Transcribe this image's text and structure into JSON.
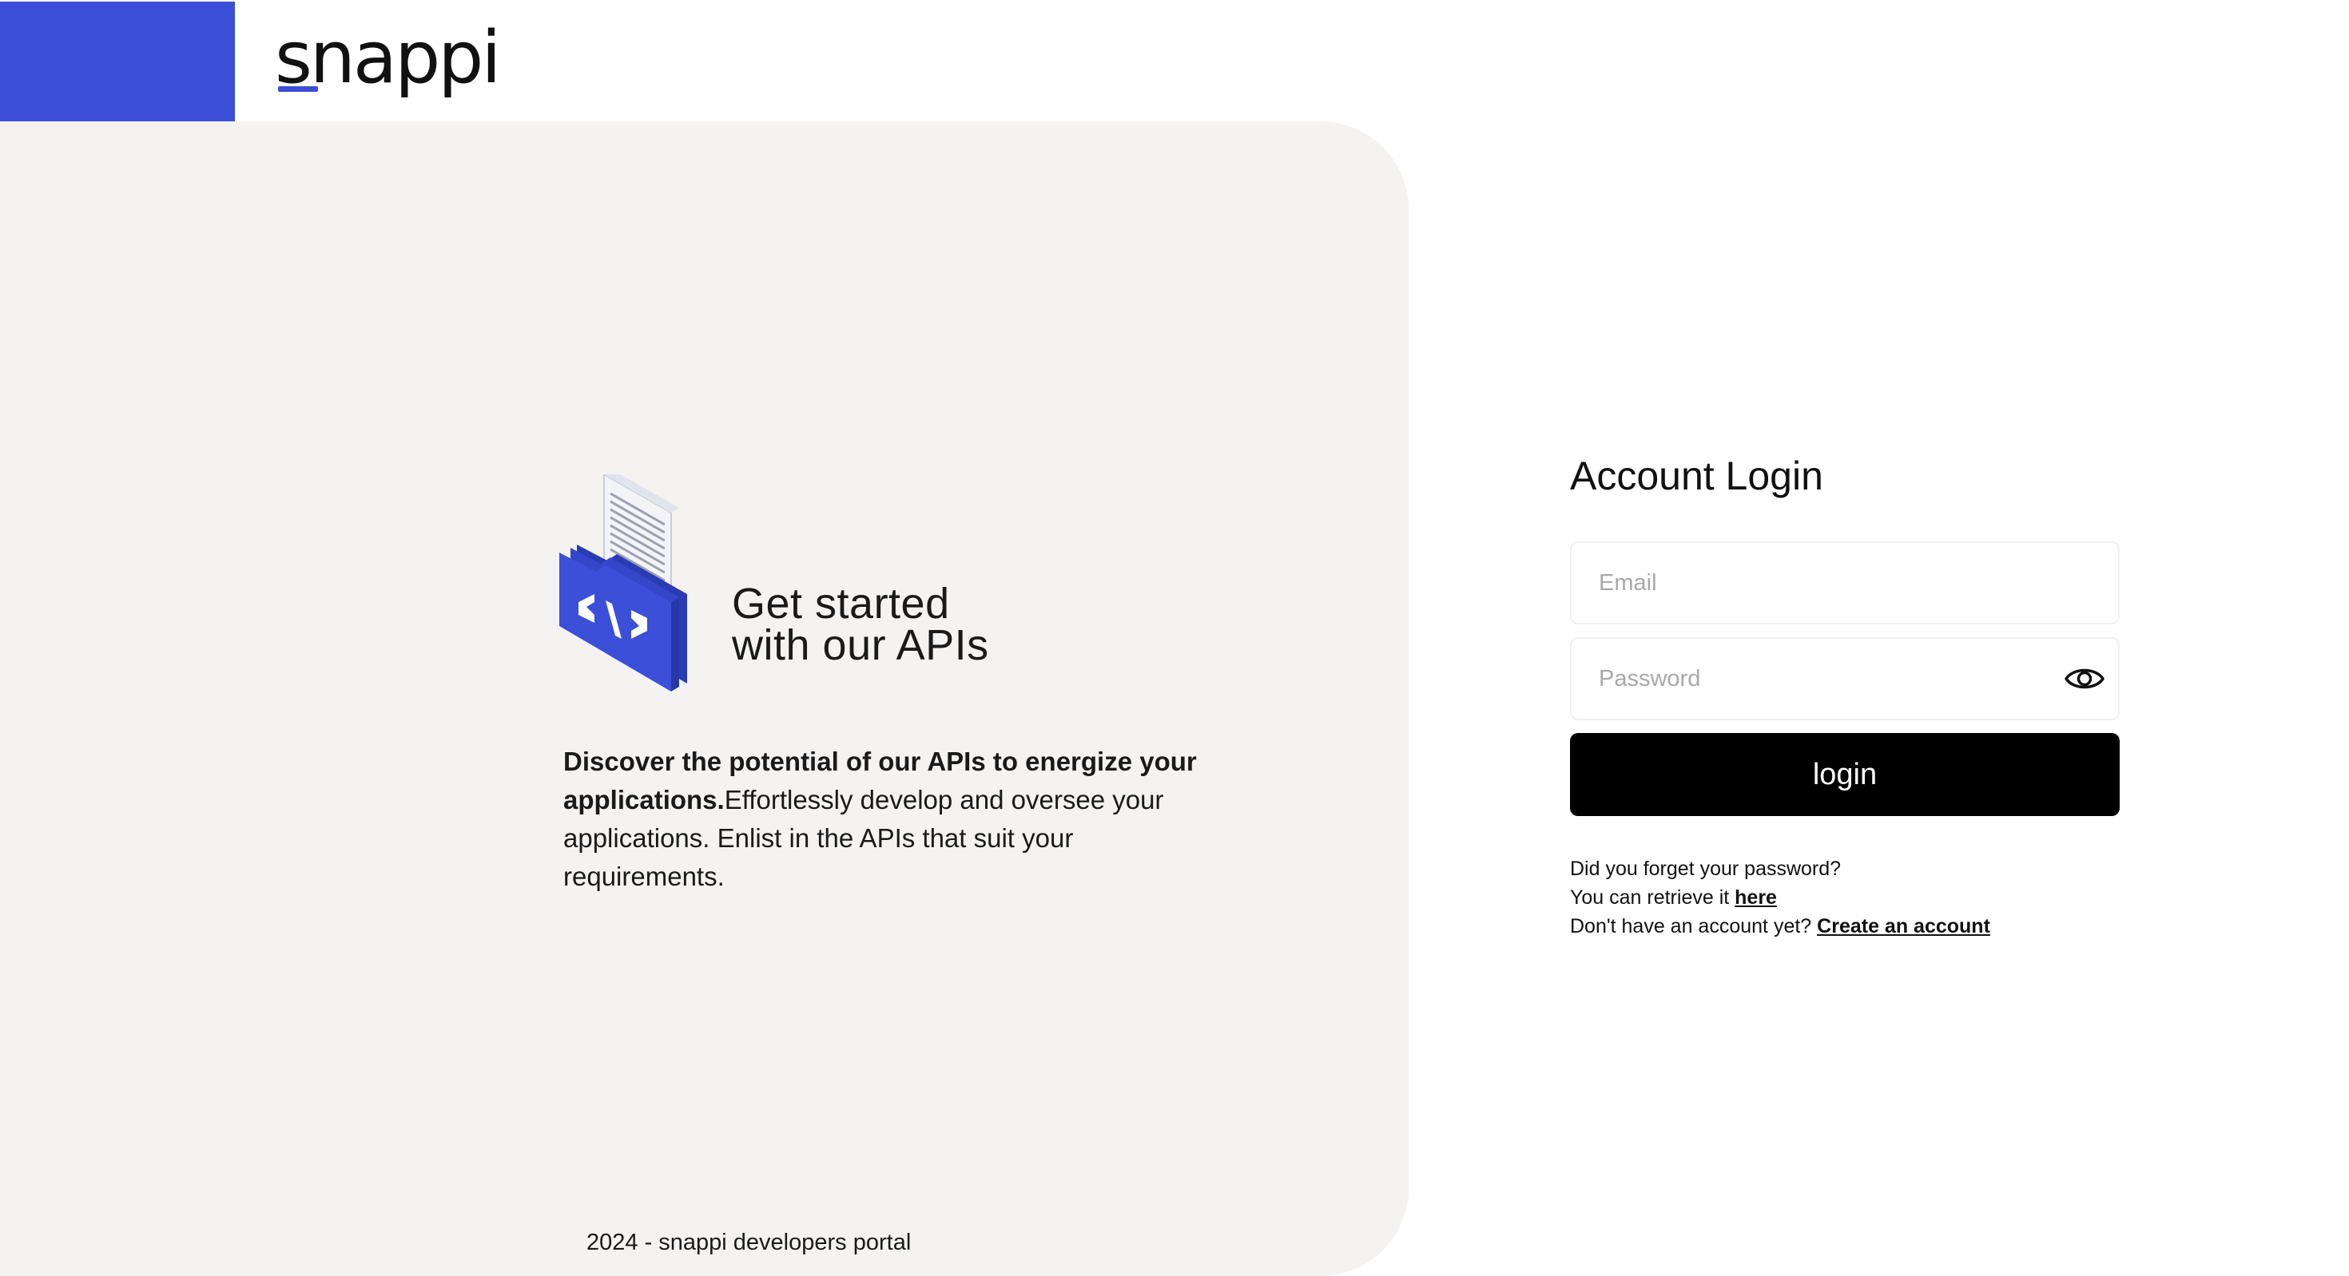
{
  "header": {
    "logo_text": "snappi",
    "brand_color": "#3b4fd8"
  },
  "hero": {
    "illustration_icon": "code-folder-icon",
    "title_line1": "Get started",
    "title_line2": "with our APIs",
    "desc_bold": "Discover the potential of our APIs to energize your applications.",
    "desc_rest": "Effortlessly develop and oversee your applications. Enlist in the APIs that suit your requirements."
  },
  "footer": {
    "text": "2024 - snappi developers portal"
  },
  "login": {
    "title": "Account Login",
    "email_placeholder": "Email",
    "password_placeholder": "Password",
    "password_toggle_icon": "eye-icon",
    "button_label": "login",
    "forgot_line": "Did you forget your password?",
    "retrieve_prefix": "You can retrieve it ",
    "retrieve_link": "here",
    "no_account_prefix": "Don't have an account yet? ",
    "create_account_link": "Create an account"
  },
  "colors": {
    "accent": "#3b4fd8",
    "panel_bg": "#f4f3f2",
    "button_bg": "#000000"
  }
}
